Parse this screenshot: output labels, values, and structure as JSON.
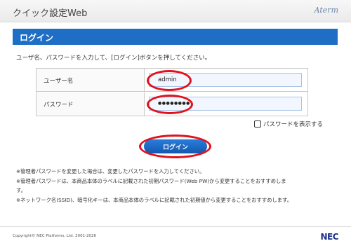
{
  "header": {
    "title": "クイック設定Web",
    "brand": "Aterm"
  },
  "section": {
    "title": "ログイン"
  },
  "instruction": "ユーザ名、パスワードを入力して、[ログイン]ボタンを押してください。",
  "form": {
    "username_label": "ユーザー名",
    "username_value": "admin",
    "password_label": "パスワード",
    "password_value": "●●●●●●●●",
    "show_password_label": "パスワードを表示する",
    "login_button": "ログイン"
  },
  "notes": [
    "※管理者パスワードを変更した場合は、変更したパスワードを入力してください。",
    "※管理者パスワードは、本商品本体のラベルに記載された初期パスワード(Web PW)から変更することをおすすめしま",
    "す。",
    "※ネットワーク名(SSID)、暗号化キーは、本商品本体のラベルに記載された初期値から変更することをおすすめします。"
  ],
  "footer": {
    "copyright": "Copyright© NEC Platforms, Ltd. 2001-2026",
    "logo": "NEC"
  },
  "colors": {
    "section_bar": "#1f6ec6",
    "annotation_ring": "#e0121d",
    "button": "#1f6ec6"
  }
}
